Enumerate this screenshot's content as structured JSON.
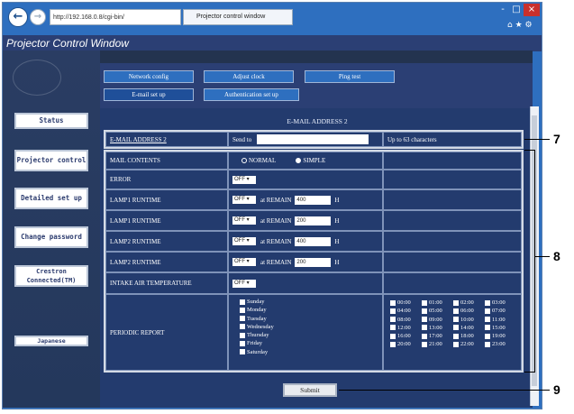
{
  "browser": {
    "address": "http://192.168.0.8/cgi-bin/",
    "tab_title": "Projector control window",
    "back_icon": "arrow-left-icon",
    "forward_icon": "arrow-right-icon",
    "window_controls": [
      "-",
      "□",
      "×"
    ]
  },
  "app": {
    "title": "Projector Control Window"
  },
  "sidebar": {
    "items": [
      {
        "label": "Status"
      },
      {
        "label": "Projector control"
      },
      {
        "label": "Detailed set up"
      },
      {
        "label": "Change password"
      },
      {
        "label": "Crestron Connected(TM)"
      }
    ],
    "language_button": "Japanese"
  },
  "tabs": {
    "row1": [
      "Network config",
      "Adjust clock",
      "Ping test"
    ],
    "row2": [
      "E-mail set up",
      "Authentication set up"
    ],
    "active": "E-mail set up"
  },
  "section_title": "E-MAIL ADDRESS 2",
  "email": {
    "label": "E-MAIL ADDRESS 2",
    "send_to_label": "Send to",
    "send_to_value": "",
    "hint": "Up to 63 characters"
  },
  "mail_contents": {
    "label": "MAIL CONTENTS",
    "options": [
      "NORMAL",
      "SIMPLE"
    ],
    "selected": "SIMPLE"
  },
  "rows": [
    {
      "label": "ERROR",
      "select": "OFF"
    },
    {
      "label": "LAMP1 RUNTIME",
      "select": "OFF",
      "remain_label": "at REMAIN",
      "remain": "400",
      "unit": "H"
    },
    {
      "label": "LAMP1 RUNTIME",
      "select": "OFF",
      "remain_label": "at REMAIN",
      "remain": "200",
      "unit": "H"
    },
    {
      "label": "LAMP2 RUNTIME",
      "select": "OFF",
      "remain_label": "at REMAIN",
      "remain": "400",
      "unit": "H"
    },
    {
      "label": "LAMP2 RUNTIME",
      "select": "OFF",
      "remain_label": "at REMAIN",
      "remain": "200",
      "unit": "H"
    },
    {
      "label": "INTAKE AIR TEMPERATURE",
      "select": "OFF"
    }
  ],
  "periodic_report": {
    "label": "PERIODIC REPORT",
    "days": [
      "Sunday",
      "Monday",
      "Tuesday",
      "Wednesday",
      "Thursday",
      "Friday",
      "Saturday"
    ],
    "hours": [
      [
        "00:00",
        "01:00",
        "02:00",
        "03:00"
      ],
      [
        "04:00",
        "05:00",
        "06:00",
        "07:00"
      ],
      [
        "08:00",
        "09:00",
        "10:00",
        "11:00"
      ],
      [
        "12:00",
        "13:00",
        "14:00",
        "15:00"
      ],
      [
        "16:00",
        "17:00",
        "18:00",
        "19:00"
      ],
      [
        "20:00",
        "21:00",
        "22:00",
        "23:00"
      ]
    ]
  },
  "submit_label": "Submit",
  "callouts": [
    "7",
    "8",
    "9"
  ]
}
